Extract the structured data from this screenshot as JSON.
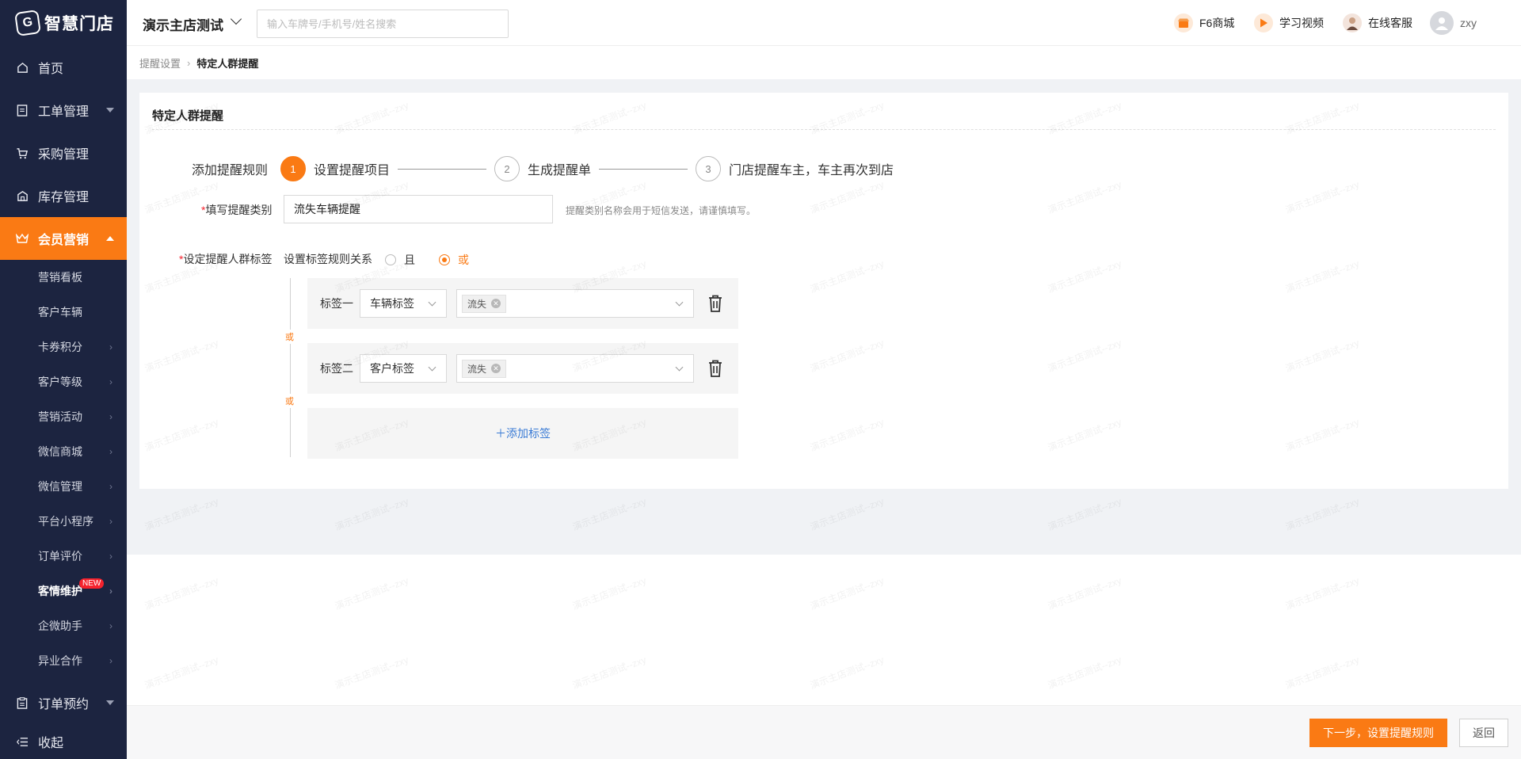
{
  "logo": {
    "mark": "G",
    "text": "智慧门店"
  },
  "sidebar": {
    "main_items": [
      {
        "label": "首页",
        "icon": "home-icon"
      },
      {
        "label": "工单管理",
        "icon": "document-icon"
      },
      {
        "label": "采购管理",
        "icon": "cart-icon"
      },
      {
        "label": "库存管理",
        "icon": "warehouse-icon"
      },
      {
        "label": "会员营销",
        "icon": "crown-icon"
      }
    ],
    "sub_items": [
      "营销看板",
      "客户车辆",
      "卡券积分",
      "客户等级",
      "营销活动",
      "微信商城",
      "微信管理",
      "平台小程序",
      "订单评价",
      "客情维护",
      "企微助手",
      "异业合作"
    ],
    "new_badge": "NEW",
    "bottom_items": [
      {
        "label": "订单预约",
        "icon": "clipboard-icon"
      },
      {
        "label": "收起",
        "icon": "collapse-icon"
      }
    ]
  },
  "header": {
    "store_name": "演示主店测试",
    "search_placeholder": "输入车牌号/手机号/姓名搜索",
    "links": [
      {
        "label": "F6商城",
        "icon": "store-icon"
      },
      {
        "label": "学习视频",
        "icon": "play-icon"
      },
      {
        "label": "在线客服",
        "icon": "agent-avatar-icon"
      }
    ],
    "username": "zxy"
  },
  "breadcrumb": {
    "parent": "提醒设置",
    "current": "特定人群提醒"
  },
  "card": {
    "title": "特定人群提醒",
    "steps_lead": "添加提醒规则",
    "steps": [
      {
        "num": "1",
        "label": "设置提醒项目"
      },
      {
        "num": "2",
        "label": "生成提醒单"
      },
      {
        "num": "3",
        "label": "门店提醒车主，车主再次到店"
      }
    ],
    "category_label": "填写提醒类别",
    "category_value": "流失车辆提醒",
    "category_hint": "提醒类别名称会用于短信发送，请谨慎填写。",
    "crowd_label": "设定提醒人群标签",
    "relation_label": "设置标签规则关系",
    "relation_options": [
      "且",
      "或"
    ],
    "relation_selected": "或",
    "or_text": "或",
    "tag_rows": [
      {
        "name": "标签一",
        "type": "车辆标签",
        "chip": "流失"
      },
      {
        "name": "标签二",
        "type": "客户标签",
        "chip": "流失"
      }
    ],
    "add_tag": "＋添加标签"
  },
  "footer": {
    "next": "下一步，设置提醒规则",
    "back": "返回"
  },
  "watermark": "演示主店测试--zxy",
  "colors": {
    "accent": "#fa7a14",
    "sidebar": "#1c2440",
    "link": "#3a7bd5"
  }
}
